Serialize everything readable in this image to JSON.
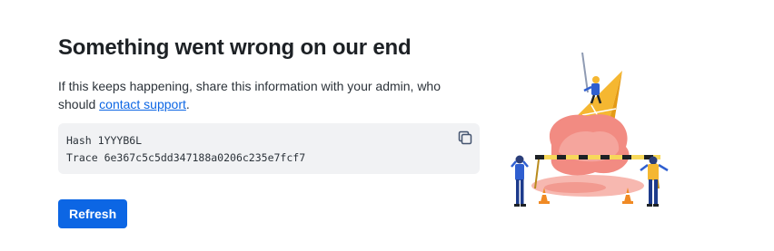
{
  "error": {
    "title": "Something went wrong on our end",
    "message_prefix": "If this keeps happening, share this information with your admin, who should ",
    "support_link": "contact support",
    "message_suffix": "."
  },
  "info": {
    "hash_label": "Hash",
    "hash_value": "1YYYB6L",
    "trace_label": "Trace",
    "trace_value": "6e367c5c5dd347188a0206c235e7fcf7"
  },
  "actions": {
    "refresh_label": "Refresh",
    "copy_icon": "copy-icon"
  },
  "illustration": {
    "description_icon": "melted-ice-cream-construction-illustration"
  },
  "colors": {
    "accent": "#0c66e4",
    "info_bg": "#f1f2f4",
    "title": "#1d2125",
    "ice_cream": "#f28b82",
    "cone": "#f5b731"
  }
}
